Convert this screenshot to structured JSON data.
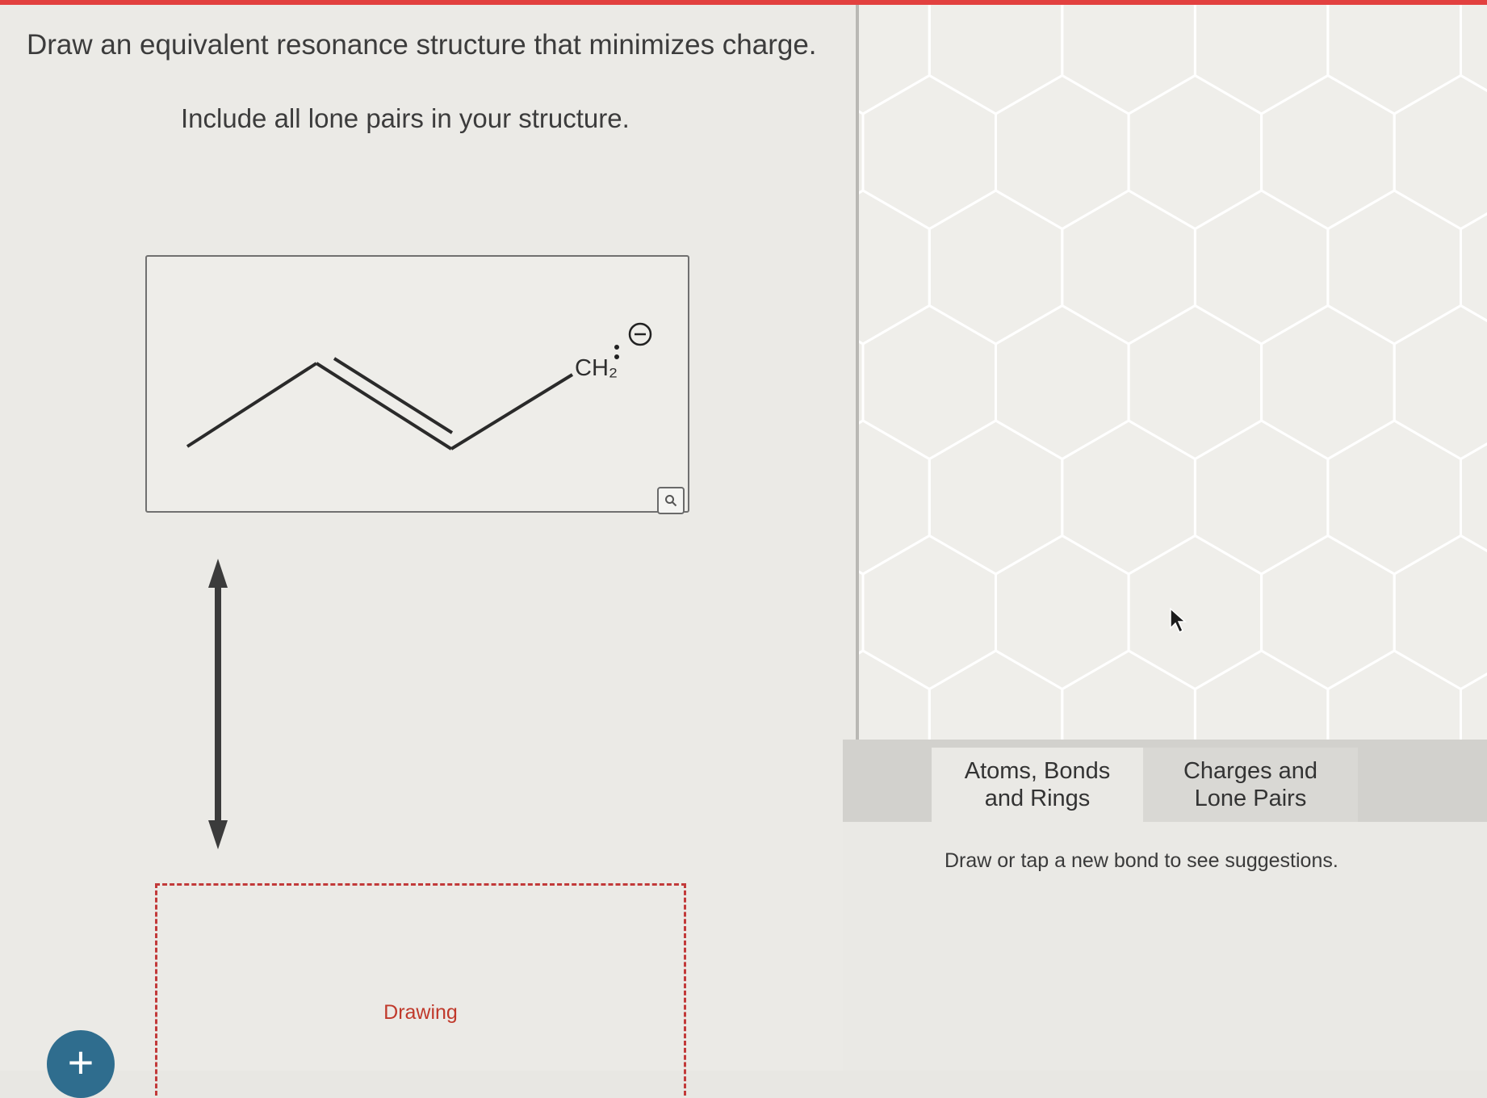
{
  "question": {
    "title": "Draw an equivalent resonance structure that minimizes charge.",
    "subtitle": "Include all lone pairs in your structure."
  },
  "molecule": {
    "group_label": "CH₂",
    "charge_symbol": "⊖",
    "lone_pair_icon": "lone-pair-dots",
    "zoom_icon": "magnifier-icon"
  },
  "arrow": {
    "icon": "double-headed-arrow"
  },
  "drawing": {
    "label": "Drawing"
  },
  "add_button": {
    "label": "+"
  },
  "toolbar": {
    "tabs": [
      {
        "label": "Atoms, Bonds\nand Rings"
      },
      {
        "label": "Charges and\nLone Pairs"
      }
    ]
  },
  "hint": {
    "text": "Draw or tap a new bond to see suggestions."
  },
  "colors": {
    "accent_red": "#e2403f",
    "drawing_border": "#c23a3a",
    "add_button": "#2f6d8e",
    "grid_line": "#ffffff"
  }
}
